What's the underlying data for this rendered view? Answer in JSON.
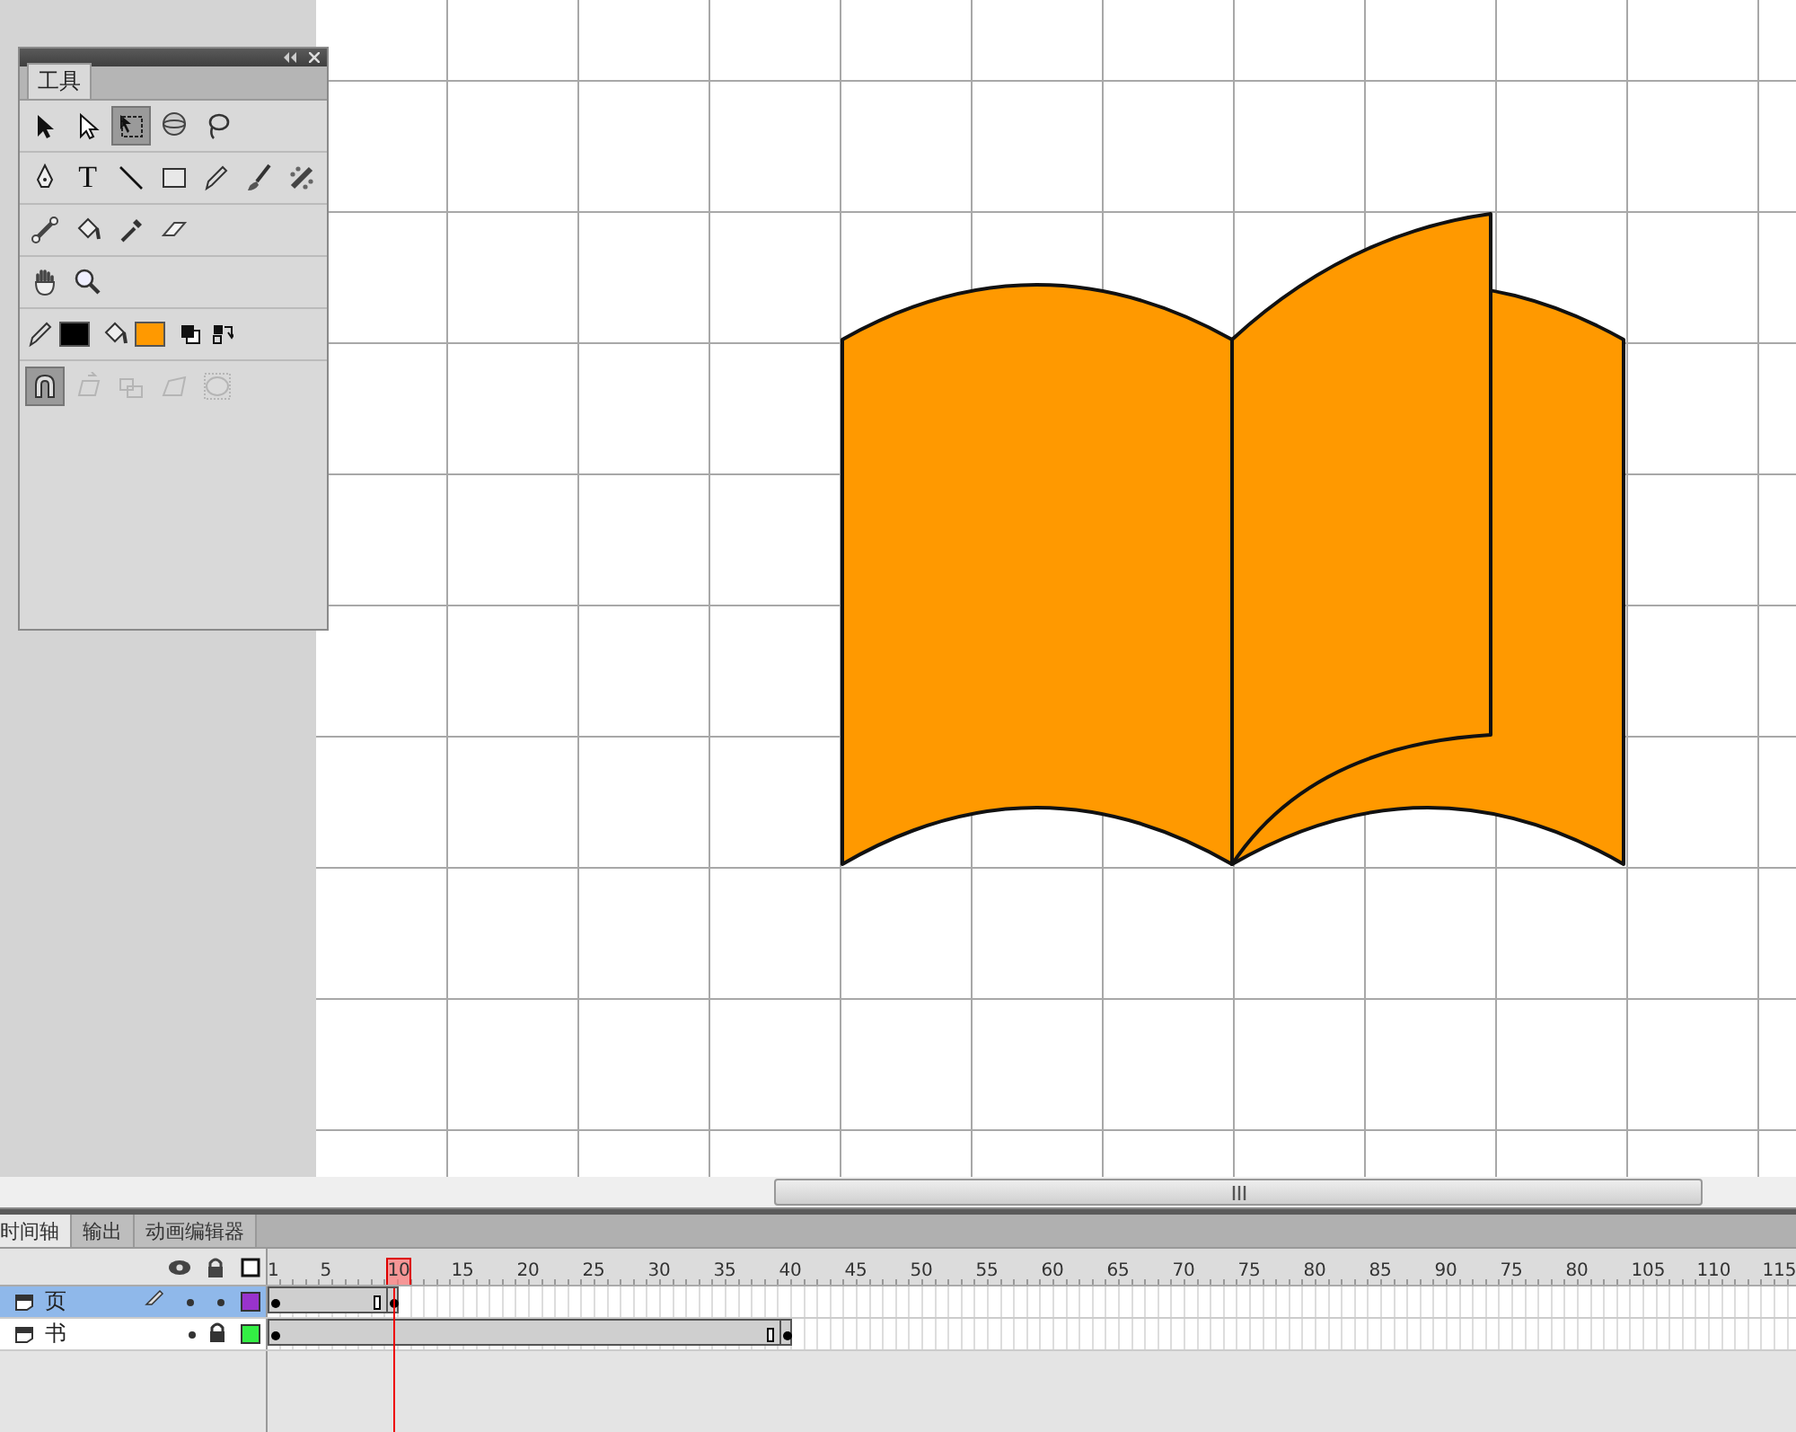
{
  "toolbox": {
    "title": "工具",
    "tool_rows": [
      [
        {
          "kind": "arrow",
          "selected": false
        },
        {
          "kind": "subselect",
          "selected": false
        },
        {
          "kind": "transform",
          "selected": true
        },
        {
          "kind": "rotate3d",
          "selected": false
        },
        {
          "kind": "lasso",
          "selected": false
        }
      ],
      [
        {
          "kind": "pen",
          "selected": false
        },
        {
          "kind": "text",
          "label": "T",
          "selected": false
        },
        {
          "kind": "line",
          "selected": false
        },
        {
          "kind": "rect",
          "selected": false
        },
        {
          "kind": "pencil",
          "selected": false
        },
        {
          "kind": "brush",
          "selected": false
        },
        {
          "kind": "deco",
          "selected": false
        }
      ],
      [
        {
          "kind": "bone",
          "selected": false
        },
        {
          "kind": "bucket",
          "selected": false
        },
        {
          "kind": "dropper",
          "selected": false
        },
        {
          "kind": "eraser",
          "selected": false
        }
      ],
      [
        {
          "kind": "hand",
          "selected": false
        },
        {
          "kind": "zoom",
          "selected": false
        }
      ]
    ],
    "colors": [
      {
        "kind": "stroke",
        "color": "#000000"
      },
      {
        "kind": "fill",
        "color": "#ff9900"
      }
    ],
    "options": [
      {
        "kind": "snap",
        "selected": true,
        "disabled": false
      },
      {
        "kind": "smooth",
        "selected": false,
        "disabled": true
      },
      {
        "kind": "straighten",
        "selected": false,
        "disabled": true
      },
      {
        "kind": "distort",
        "selected": false,
        "disabled": true
      },
      {
        "kind": "envelope",
        "selected": false,
        "disabled": true
      }
    ]
  },
  "timeline": {
    "tabs": [
      {
        "label": "时间轴",
        "selected": true
      },
      {
        "label": "输出",
        "selected": false
      },
      {
        "label": "动画编辑器",
        "selected": false
      }
    ],
    "ruler": [
      {
        "label": "1",
        "selected": false
      },
      {
        "label": "5",
        "selected": false
      },
      {
        "label": "10",
        "selected": true
      },
      {
        "label": "15",
        "selected": false
      },
      {
        "label": "20",
        "selected": false
      },
      {
        "label": "25",
        "selected": false
      },
      {
        "label": "30",
        "selected": false
      },
      {
        "label": "35",
        "selected": false
      },
      {
        "label": "40",
        "selected": false
      },
      {
        "label": "45",
        "selected": false
      },
      {
        "label": "50",
        "selected": false
      },
      {
        "label": "55",
        "selected": false
      },
      {
        "label": "60",
        "selected": false
      },
      {
        "label": "65",
        "selected": false
      },
      {
        "label": "70",
        "selected": false
      },
      {
        "label": "75",
        "selected": false
      },
      {
        "label": "80",
        "selected": false
      },
      {
        "label": "85",
        "selected": false
      },
      {
        "label": "90",
        "selected": false
      },
      {
        "label": "75",
        "selected": false
      },
      {
        "label": "80",
        "selected": false
      },
      {
        "label": "105",
        "selected": false
      },
      {
        "label": "110",
        "selected": false
      },
      {
        "label": "115",
        "selected": false
      }
    ],
    "layers": [
      {
        "name": "页",
        "selected": true,
        "editing": true,
        "locked": false,
        "color": "#9933cc",
        "frames": [
          {
            "kind": "keyframe"
          },
          {
            "kind": "frame"
          },
          {
            "kind": "frame"
          },
          {
            "kind": "frame"
          },
          {
            "kind": "frame"
          },
          {
            "kind": "frame"
          },
          {
            "kind": "frame"
          },
          {
            "kind": "frame"
          },
          {
            "kind": "end"
          },
          {
            "kind": "keyframe"
          }
        ]
      },
      {
        "name": "书",
        "selected": false,
        "editing": false,
        "locked": true,
        "color": "#33ee44",
        "frames": [
          {
            "kind": "keyframe"
          },
          {
            "kind": "frame"
          },
          {
            "kind": "frame"
          },
          {
            "kind": "frame"
          },
          {
            "kind": "frame"
          },
          {
            "kind": "frame"
          },
          {
            "kind": "frame"
          },
          {
            "kind": "frame"
          },
          {
            "kind": "frame"
          },
          {
            "kind": "frame"
          },
          {
            "kind": "frame"
          },
          {
            "kind": "frame"
          },
          {
            "kind": "frame"
          },
          {
            "kind": "frame"
          },
          {
            "kind": "frame"
          },
          {
            "kind": "frame"
          },
          {
            "kind": "frame"
          },
          {
            "kind": "frame"
          },
          {
            "kind": "frame"
          },
          {
            "kind": "frame"
          },
          {
            "kind": "frame"
          },
          {
            "kind": "frame"
          },
          {
            "kind": "frame"
          },
          {
            "kind": "frame"
          },
          {
            "kind": "frame"
          },
          {
            "kind": "frame"
          },
          {
            "kind": "frame"
          },
          {
            "kind": "frame"
          },
          {
            "kind": "frame"
          },
          {
            "kind": "frame"
          },
          {
            "kind": "frame"
          },
          {
            "kind": "frame"
          },
          {
            "kind": "frame"
          },
          {
            "kind": "frame"
          },
          {
            "kind": "frame"
          },
          {
            "kind": "frame"
          },
          {
            "kind": "frame"
          },
          {
            "kind": "frame"
          },
          {
            "kind": "end"
          },
          {
            "kind": "keyframe"
          }
        ]
      }
    ]
  }
}
